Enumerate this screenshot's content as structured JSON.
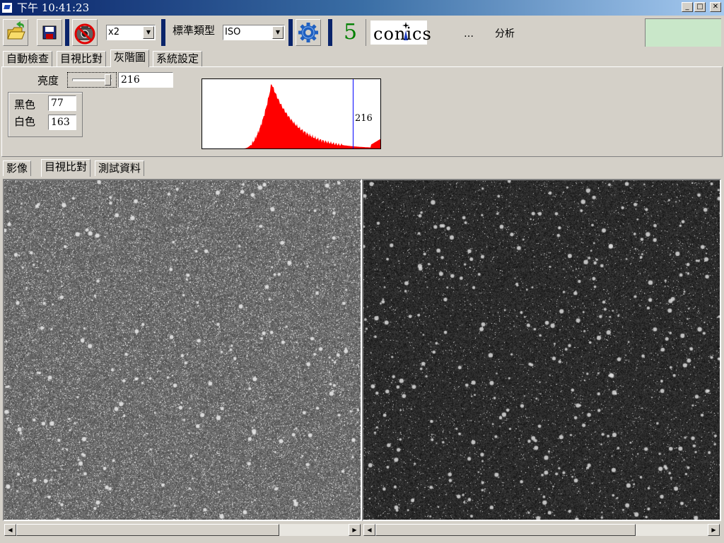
{
  "window": {
    "title": "下午 10:41:23"
  },
  "toolbar": {
    "zoom_value": "x2",
    "standard_type_label": "標準類型",
    "standard_type_value": "ISO",
    "number_value": "5",
    "logo_text": "conics",
    "ellipsis_text": "…",
    "analysis_label": "分析",
    "accent_color": "#c9e7c9"
  },
  "main_tabs": [
    {
      "label": "自動檢查"
    },
    {
      "label": "目視比對"
    },
    {
      "label": "灰階圖"
    },
    {
      "label": "系統設定"
    }
  ],
  "grayscale_panel": {
    "brightness_label": "亮度",
    "brightness_value": "216",
    "black_label": "黑色",
    "black_value": "77",
    "white_label": "白色",
    "white_value": "163",
    "histogram_marker_label": "216",
    "histogram_color": "#ff0000",
    "marker_color": "#0000ff"
  },
  "view_tabs": [
    {
      "label": "影像"
    },
    {
      "label": "目視比對"
    },
    {
      "label": "測試資料"
    }
  ]
}
